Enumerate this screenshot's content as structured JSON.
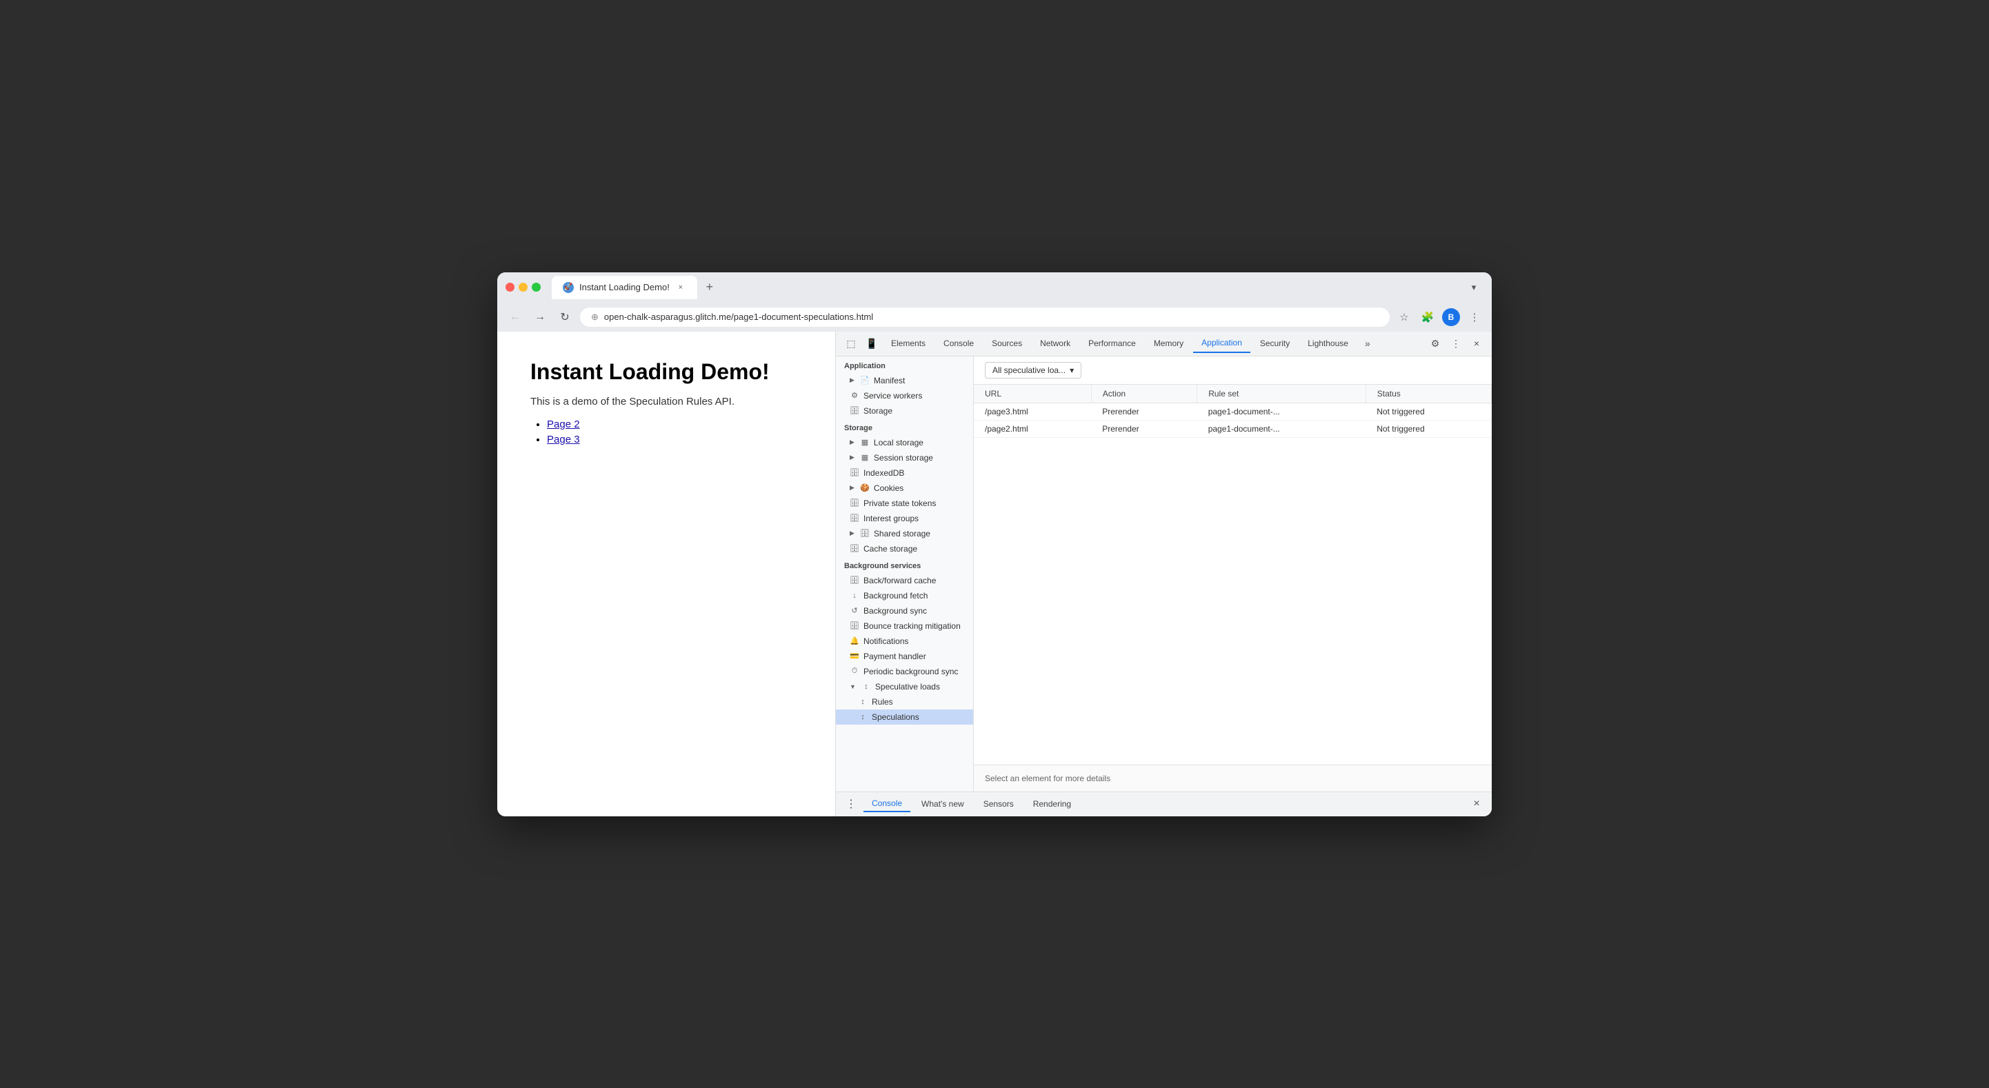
{
  "window": {
    "title": "Instant Loading Demo!",
    "url": "open-chalk-asparagus.glitch.me/page1-document-speculations.html"
  },
  "page": {
    "title": "Instant Loading Demo!",
    "subtitle": "This is a demo of the Speculation Rules API.",
    "links": [
      "Page 2",
      "Page 3"
    ]
  },
  "devtools": {
    "tabs": [
      {
        "label": "Elements",
        "active": false
      },
      {
        "label": "Console",
        "active": false
      },
      {
        "label": "Sources",
        "active": false
      },
      {
        "label": "Network",
        "active": false
      },
      {
        "label": "Performance",
        "active": false
      },
      {
        "label": "Memory",
        "active": false
      },
      {
        "label": "Application",
        "active": true
      },
      {
        "label": "Security",
        "active": false
      },
      {
        "label": "Lighthouse",
        "active": false
      }
    ],
    "sidebar": {
      "application_section": "Application",
      "application_items": [
        {
          "label": "Manifest",
          "icon": "📄",
          "indent": 1
        },
        {
          "label": "Service workers",
          "icon": "⚙️",
          "indent": 1
        },
        {
          "label": "Storage",
          "icon": "🗄️",
          "indent": 1
        }
      ],
      "storage_section": "Storage",
      "storage_items": [
        {
          "label": "Local storage",
          "icon": "▶",
          "indent": 1,
          "expandable": true
        },
        {
          "label": "Session storage",
          "icon": "▶",
          "indent": 1,
          "expandable": true
        },
        {
          "label": "IndexedDB",
          "icon": "",
          "indent": 1
        },
        {
          "label": "Cookies",
          "icon": "▶",
          "indent": 1,
          "expandable": true
        },
        {
          "label": "Private state tokens",
          "icon": "",
          "indent": 1
        },
        {
          "label": "Interest groups",
          "icon": "",
          "indent": 1
        },
        {
          "label": "Shared storage",
          "icon": "▶",
          "indent": 1,
          "expandable": true
        },
        {
          "label": "Cache storage",
          "icon": "",
          "indent": 1
        }
      ],
      "background_section": "Background services",
      "background_items": [
        {
          "label": "Back/forward cache",
          "icon": "🗄️",
          "indent": 1
        },
        {
          "label": "Background fetch",
          "icon": "↓",
          "indent": 1
        },
        {
          "label": "Background sync",
          "icon": "↺",
          "indent": 1
        },
        {
          "label": "Bounce tracking mitigation",
          "icon": "🗄️",
          "indent": 1
        },
        {
          "label": "Notifications",
          "icon": "🔔",
          "indent": 1
        },
        {
          "label": "Payment handler",
          "icon": "💳",
          "indent": 1
        },
        {
          "label": "Periodic background sync",
          "icon": "⏱️",
          "indent": 1
        },
        {
          "label": "Speculative loads",
          "icon": "↕",
          "indent": 1,
          "expandable": true,
          "expanded": true
        },
        {
          "label": "Rules",
          "icon": "↕",
          "indent": 2
        },
        {
          "label": "Speculations",
          "icon": "↕",
          "indent": 2,
          "active": true
        }
      ]
    },
    "main": {
      "dropdown_label": "All speculative loa...",
      "table": {
        "headers": [
          "URL",
          "Action",
          "Rule set",
          "Status"
        ],
        "rows": [
          {
            "url": "/page3.html",
            "action": "Prerender",
            "ruleset": "page1-document-...",
            "status": "Not triggered"
          },
          {
            "url": "/page2.html",
            "action": "Prerender",
            "ruleset": "page1-document-...",
            "status": "Not triggered"
          }
        ]
      },
      "details_text": "Select an element for more details"
    }
  },
  "bottom_bar": {
    "tabs": [
      {
        "label": "Console",
        "active": true
      },
      {
        "label": "What's new",
        "active": false
      },
      {
        "label": "Sensors",
        "active": false
      },
      {
        "label": "Rendering",
        "active": false
      }
    ]
  },
  "icons": {
    "back": "←",
    "forward": "→",
    "reload": "↻",
    "star": "☆",
    "extensions": "🧩",
    "profile": "B",
    "more": "⋮",
    "chevron_down": "▾",
    "close": "×",
    "new_tab": "+",
    "dots_vertical": "⋮",
    "gear": "⚙",
    "inspect": "⬚",
    "device": "📱"
  }
}
